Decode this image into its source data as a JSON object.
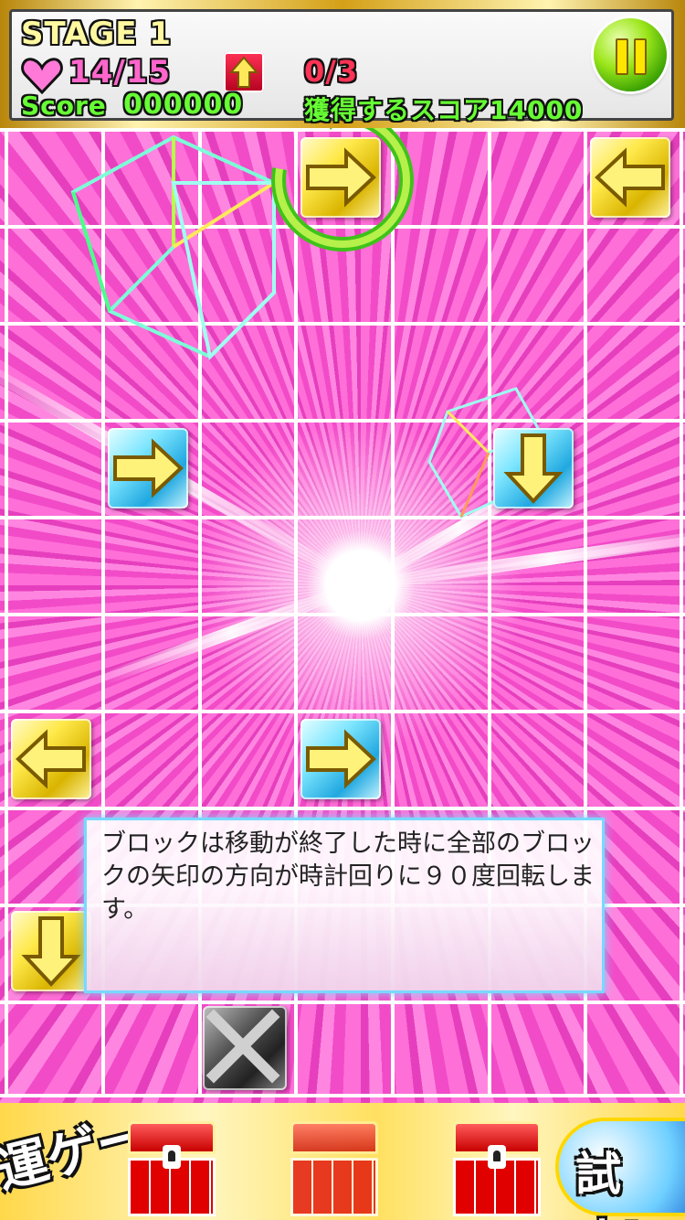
{
  "hud": {
    "stage_label": "STAGE 1",
    "moves_text": "14/15",
    "score_label": "Score",
    "score_value": "000000",
    "goal_count": "0/3",
    "target_score_text": "獲得するスコア14000"
  },
  "icons": {
    "heart": "heart-icon",
    "up_arrow": "up-arrow-icon",
    "pause": "pause-icon"
  },
  "board": {
    "columns": 7,
    "rows": 10,
    "blocks": [
      {
        "col": 3,
        "row": 0,
        "style": "gold",
        "direction": "right"
      },
      {
        "col": 6,
        "row": 0,
        "style": "gold",
        "direction": "left"
      },
      {
        "col": 1,
        "row": 3,
        "style": "blue",
        "direction": "right"
      },
      {
        "col": 5,
        "row": 3,
        "style": "blue",
        "direction": "down"
      },
      {
        "col": 0,
        "row": 6,
        "style": "gold",
        "direction": "left"
      },
      {
        "col": 3,
        "row": 6,
        "style": "blue",
        "direction": "right"
      },
      {
        "col": 0,
        "row": 8,
        "style": "gold",
        "direction": "down"
      },
      {
        "col": 2,
        "row": 9,
        "style": "dark",
        "direction": "x"
      }
    ]
  },
  "dialog": {
    "text": "ブロックは移動が終了した時に全部のブロックの矢印の方向が時計回りに９０度回転します。"
  },
  "banner": {
    "left_text": "運ゲー",
    "right_text": "試す!"
  },
  "colors": {
    "background_pink": "#ff4fd0",
    "grid_line": "#ffffff",
    "score_green": "#66ff33",
    "goal_red": "#ff3355",
    "dialog_border": "#7ad8ff"
  }
}
